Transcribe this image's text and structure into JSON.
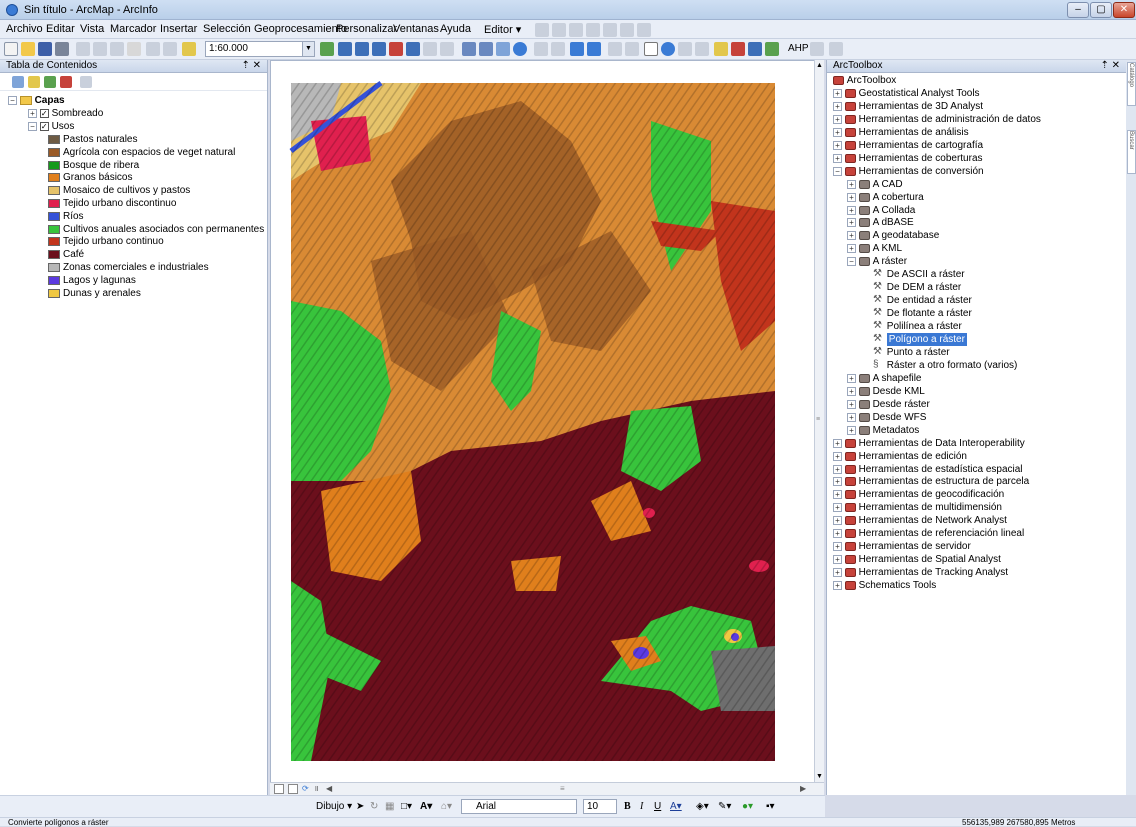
{
  "window": {
    "title": "Sin título - ArcMap - ArcInfo"
  },
  "menu": [
    "Archivo",
    "Editar",
    "Vista",
    "Marcador",
    "Insertar",
    "Selección",
    "Geoprocesamiento",
    "Personalizar",
    "Ventanas",
    "Ayuda",
    "Editor ▾"
  ],
  "toolbar": {
    "scale": "1:60.000",
    "ahp": "AHP"
  },
  "toc": {
    "title": "Tabla de Contenidos",
    "root": "Capas",
    "layer1": "Sombreado",
    "layer2": "Usos",
    "legend": [
      {
        "label": "Pastos naturales",
        "color": "#6e5b44"
      },
      {
        "label": "Agrícola con espacios de veget natural",
        "color": "#9a5a26"
      },
      {
        "label": "Bosque de ribera",
        "color": "#169a1c"
      },
      {
        "label": "Granos básicos",
        "color": "#e07f1c"
      },
      {
        "label": "Mosaico de cultivos y pastos",
        "color": "#e6c36a"
      },
      {
        "label": "Tejido urbano discontinuo",
        "color": "#e0204e"
      },
      {
        "label": "Ríos",
        "color": "#3552d8"
      },
      {
        "label": "Cultivos anuales asociados con permanentes",
        "color": "#38c43c"
      },
      {
        "label": "Tejido urbano continuo",
        "color": "#c2341c"
      },
      {
        "label": "Café",
        "color": "#6b0f1c"
      },
      {
        "label": "Zonas comerciales e industriales",
        "color": "#b8b8b8"
      },
      {
        "label": "Lagos y lagunas",
        "color": "#5b3ae0"
      },
      {
        "label": "Dunas y arenales",
        "color": "#f0c842"
      }
    ]
  },
  "toolbox": {
    "title": "ArcToolbox",
    "root": "ArcToolbox",
    "items_before": [
      "Geostatistical Analyst Tools",
      "Herramientas de 3D Analyst",
      "Herramientas de administración de datos",
      "Herramientas de análisis",
      "Herramientas de cartografía",
      "Herramientas de coberturas",
      "Herramientas de conversión"
    ],
    "conversion_children": [
      "A CAD",
      "A cobertura",
      "A Collada",
      "A dBASE",
      "A geodatabase",
      "A KML",
      "A ráster"
    ],
    "raster_tools": [
      "De ASCII a ráster",
      "De DEM a ráster",
      "De entidad a ráster",
      "De flotante a ráster",
      "Polilínea a ráster",
      "Polígono a ráster",
      "Punto a ráster",
      "Ráster a otro formato (varios)"
    ],
    "conversion_after": [
      "A shapefile",
      "Desde KML",
      "Desde ráster",
      "Desde WFS",
      "Metadatos"
    ],
    "items_after": [
      "Herramientas de Data Interoperability",
      "Herramientas de edición",
      "Herramientas de estadística espacial",
      "Herramientas de estructura de parcela",
      "Herramientas de geocodificación",
      "Herramientas de multidimensión",
      "Herramientas de Network Analyst",
      "Herramientas de referenciación lineal",
      "Herramientas de servidor",
      "Herramientas de Spatial Analyst",
      "Herramientas de Tracking Analyst",
      "Schematics Tools"
    ]
  },
  "side_tabs": [
    "Catálogo",
    "Buscar"
  ],
  "drawbar": {
    "dibujo": "Dibujo ▾",
    "font": "Arial",
    "size": "10"
  },
  "status": {
    "left": "Convierte polígonos a ráster",
    "coords": "556135,989  267580,895 Metros"
  }
}
